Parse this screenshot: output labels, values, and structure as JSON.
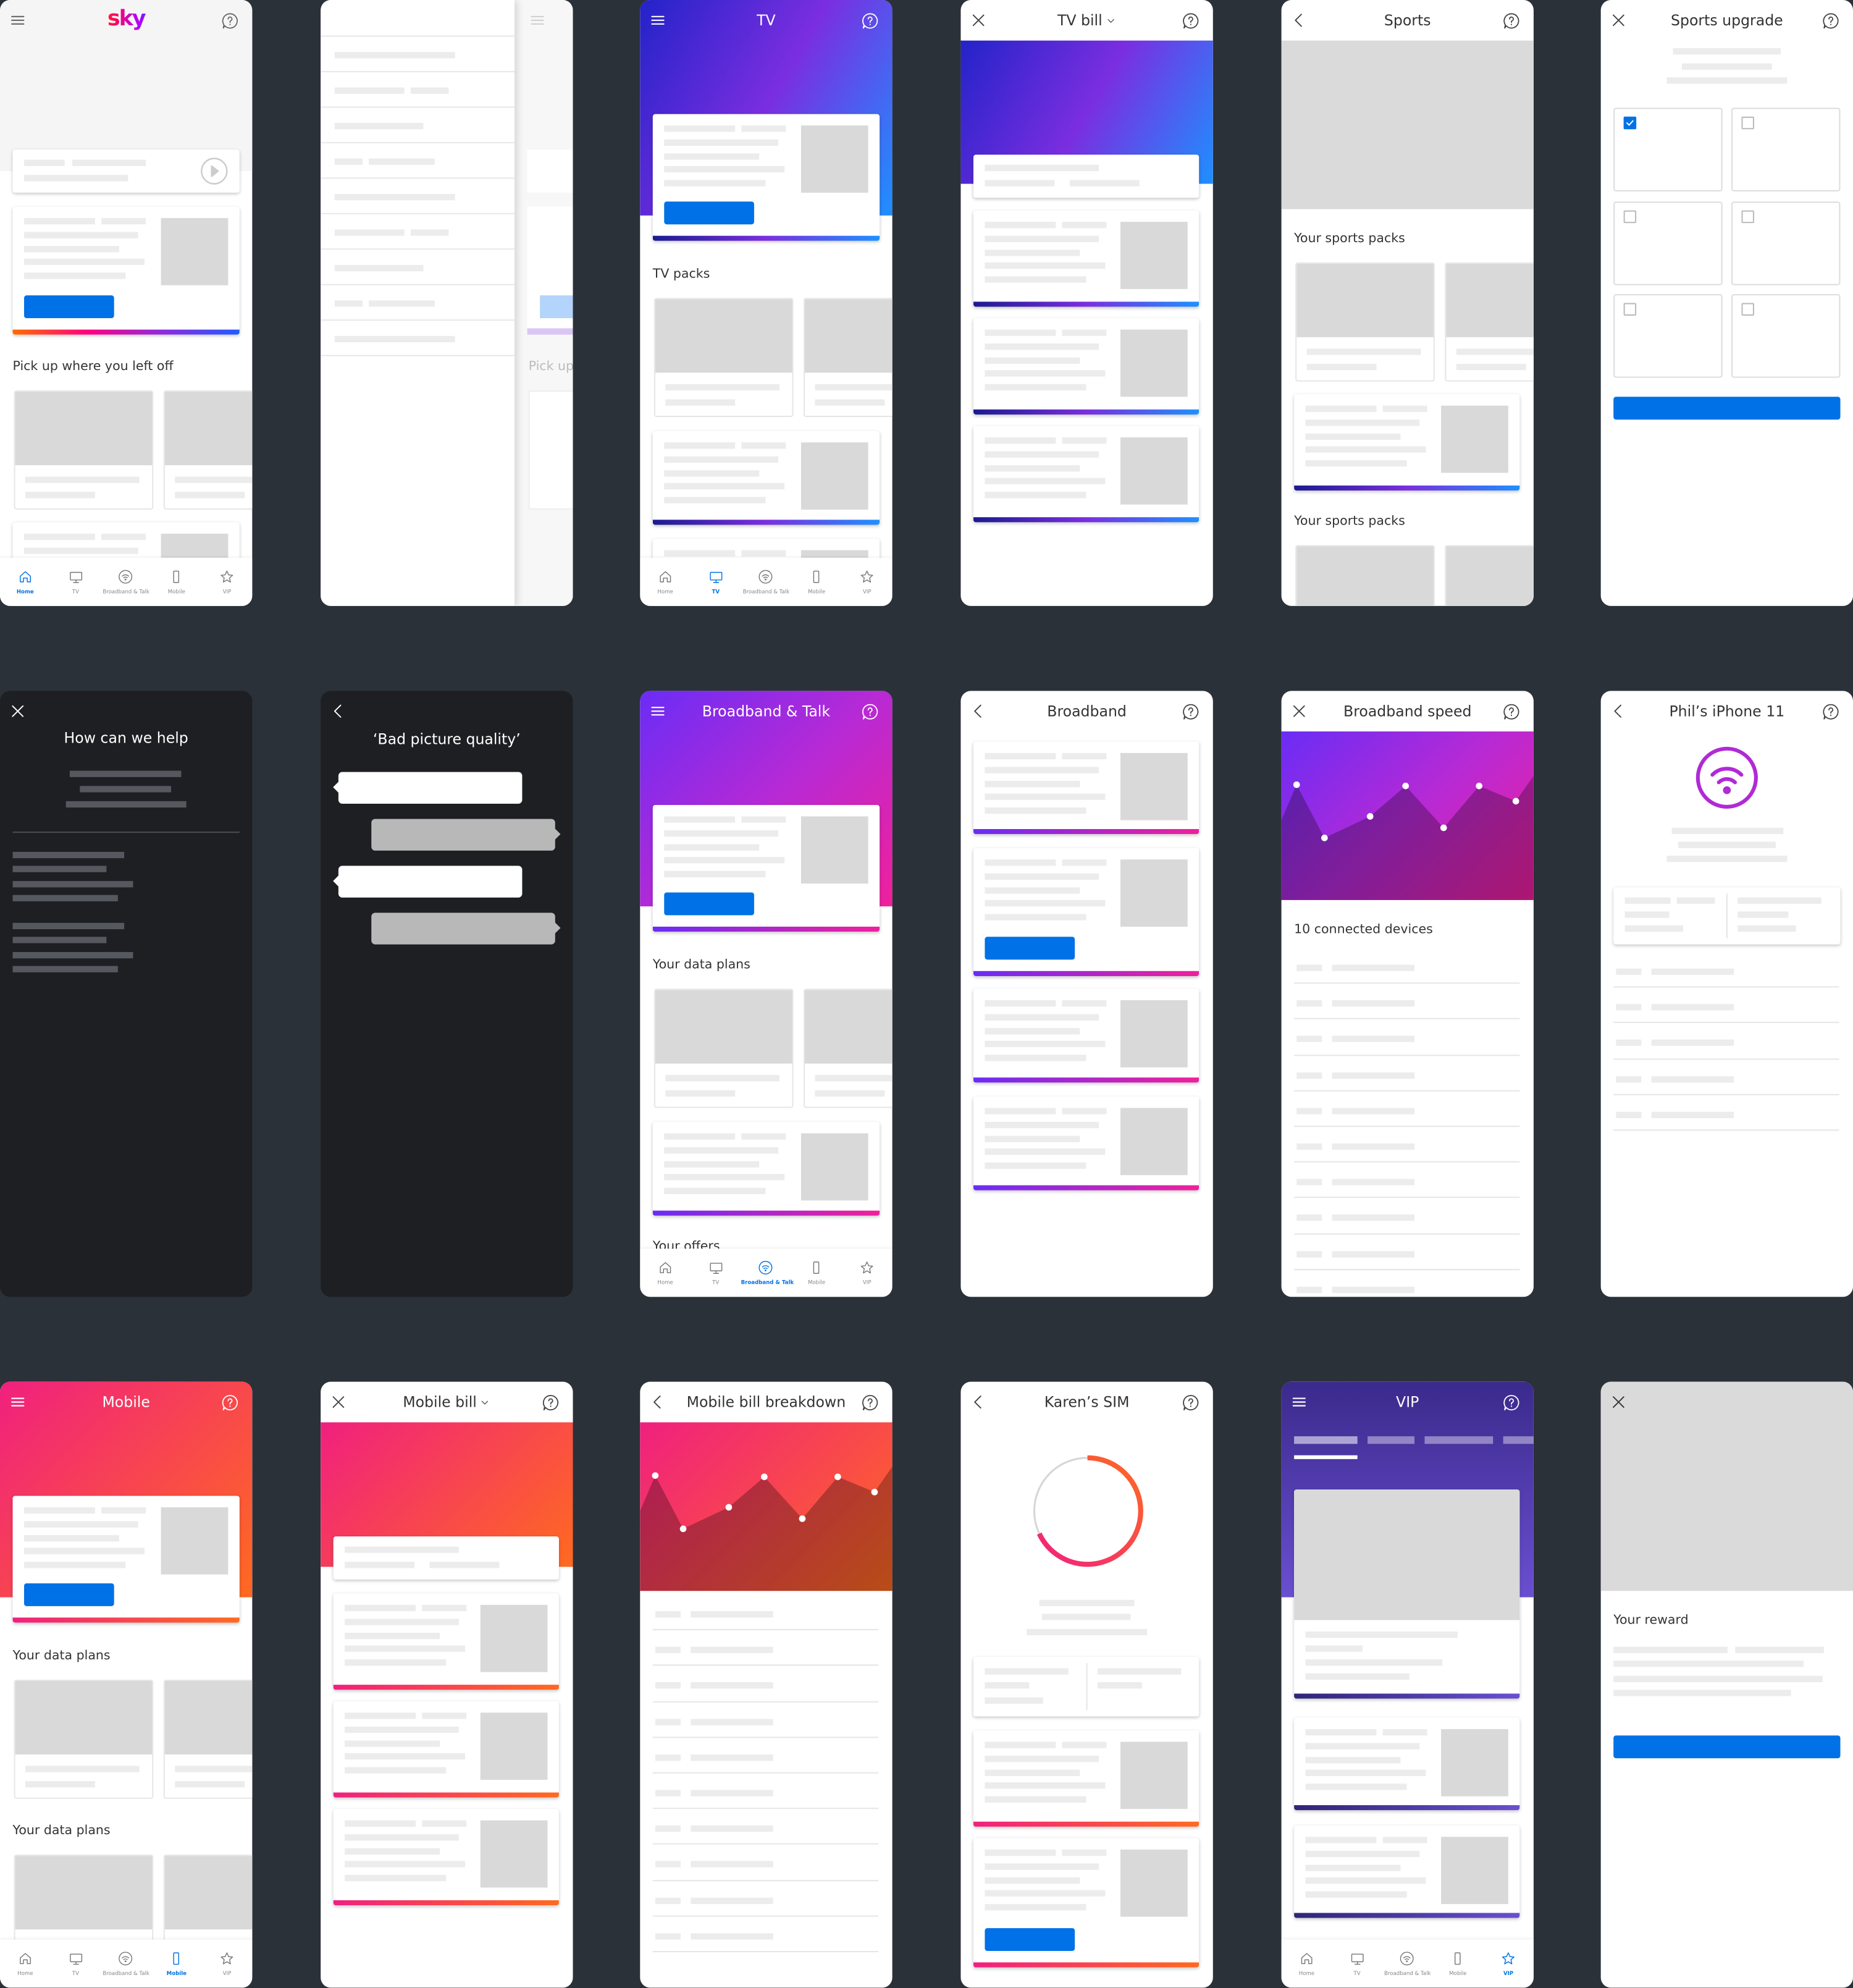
{
  "colors": {
    "background": "#2b3139",
    "accent": "#0071e6",
    "sky_bar": [
      "#ff6a00",
      "#ff0080",
      "#8a2be2",
      "#1f5cff"
    ],
    "tv": [
      "#2323c8",
      "#7a2ee0",
      "#1e90ff"
    ],
    "broadband": [
      "#6a2cf5",
      "#b52ad6",
      "#f0209c"
    ],
    "mobile": [
      "#f0207f",
      "#ff6a20"
    ],
    "vip": [
      "#3b2a8c",
      "#6a4fd0"
    ],
    "dark_screen": "#1d1f22"
  },
  "nav": {
    "items": [
      {
        "label": "Home",
        "icon": "home-icon"
      },
      {
        "label": "TV",
        "icon": "tv-icon"
      },
      {
        "label": "Broadband & Talk",
        "icon": "wifi-icon"
      },
      {
        "label": "Mobile",
        "icon": "mobile-icon"
      },
      {
        "label": "VIP",
        "icon": "star-icon"
      }
    ]
  },
  "screens": {
    "home": {
      "logo": "sky",
      "label": "Pick up where you left off"
    },
    "menu": {
      "faded_label": "Pick up"
    },
    "tv": {
      "title": "TV",
      "label": "TV packs"
    },
    "tv_bill": {
      "title": "TV bill"
    },
    "sports": {
      "title": "Sports",
      "label1": "Your sports packs",
      "label2": "Your sports packs"
    },
    "sports_upgrade": {
      "title": "Sports upgrade",
      "checked": [
        true,
        false,
        false,
        false,
        false,
        false
      ]
    },
    "help": {
      "title": "How can we help"
    },
    "chat": {
      "title": "‘Bad picture quality’"
    },
    "bb": {
      "title": "Broadband & Talk",
      "label1": "Your data plans",
      "label2": "Your offers"
    },
    "broadband": {
      "title": "Broadband"
    },
    "bb_speed": {
      "title": "Broadband speed",
      "label": "10 connected devices"
    },
    "iphone": {
      "title": "Phil’s iPhone 11"
    },
    "mobile": {
      "title": "Mobile",
      "label1": "Your data plans",
      "label2": "Your data plans"
    },
    "mobile_bill": {
      "title": "Mobile bill"
    },
    "breakdown": {
      "title": "Mobile bill breakdown"
    },
    "sim": {
      "title": "Karen’s SIM",
      "usage_fraction": 0.68
    },
    "vip": {
      "title": "VIP"
    },
    "reward": {
      "label": "Your reward"
    }
  }
}
